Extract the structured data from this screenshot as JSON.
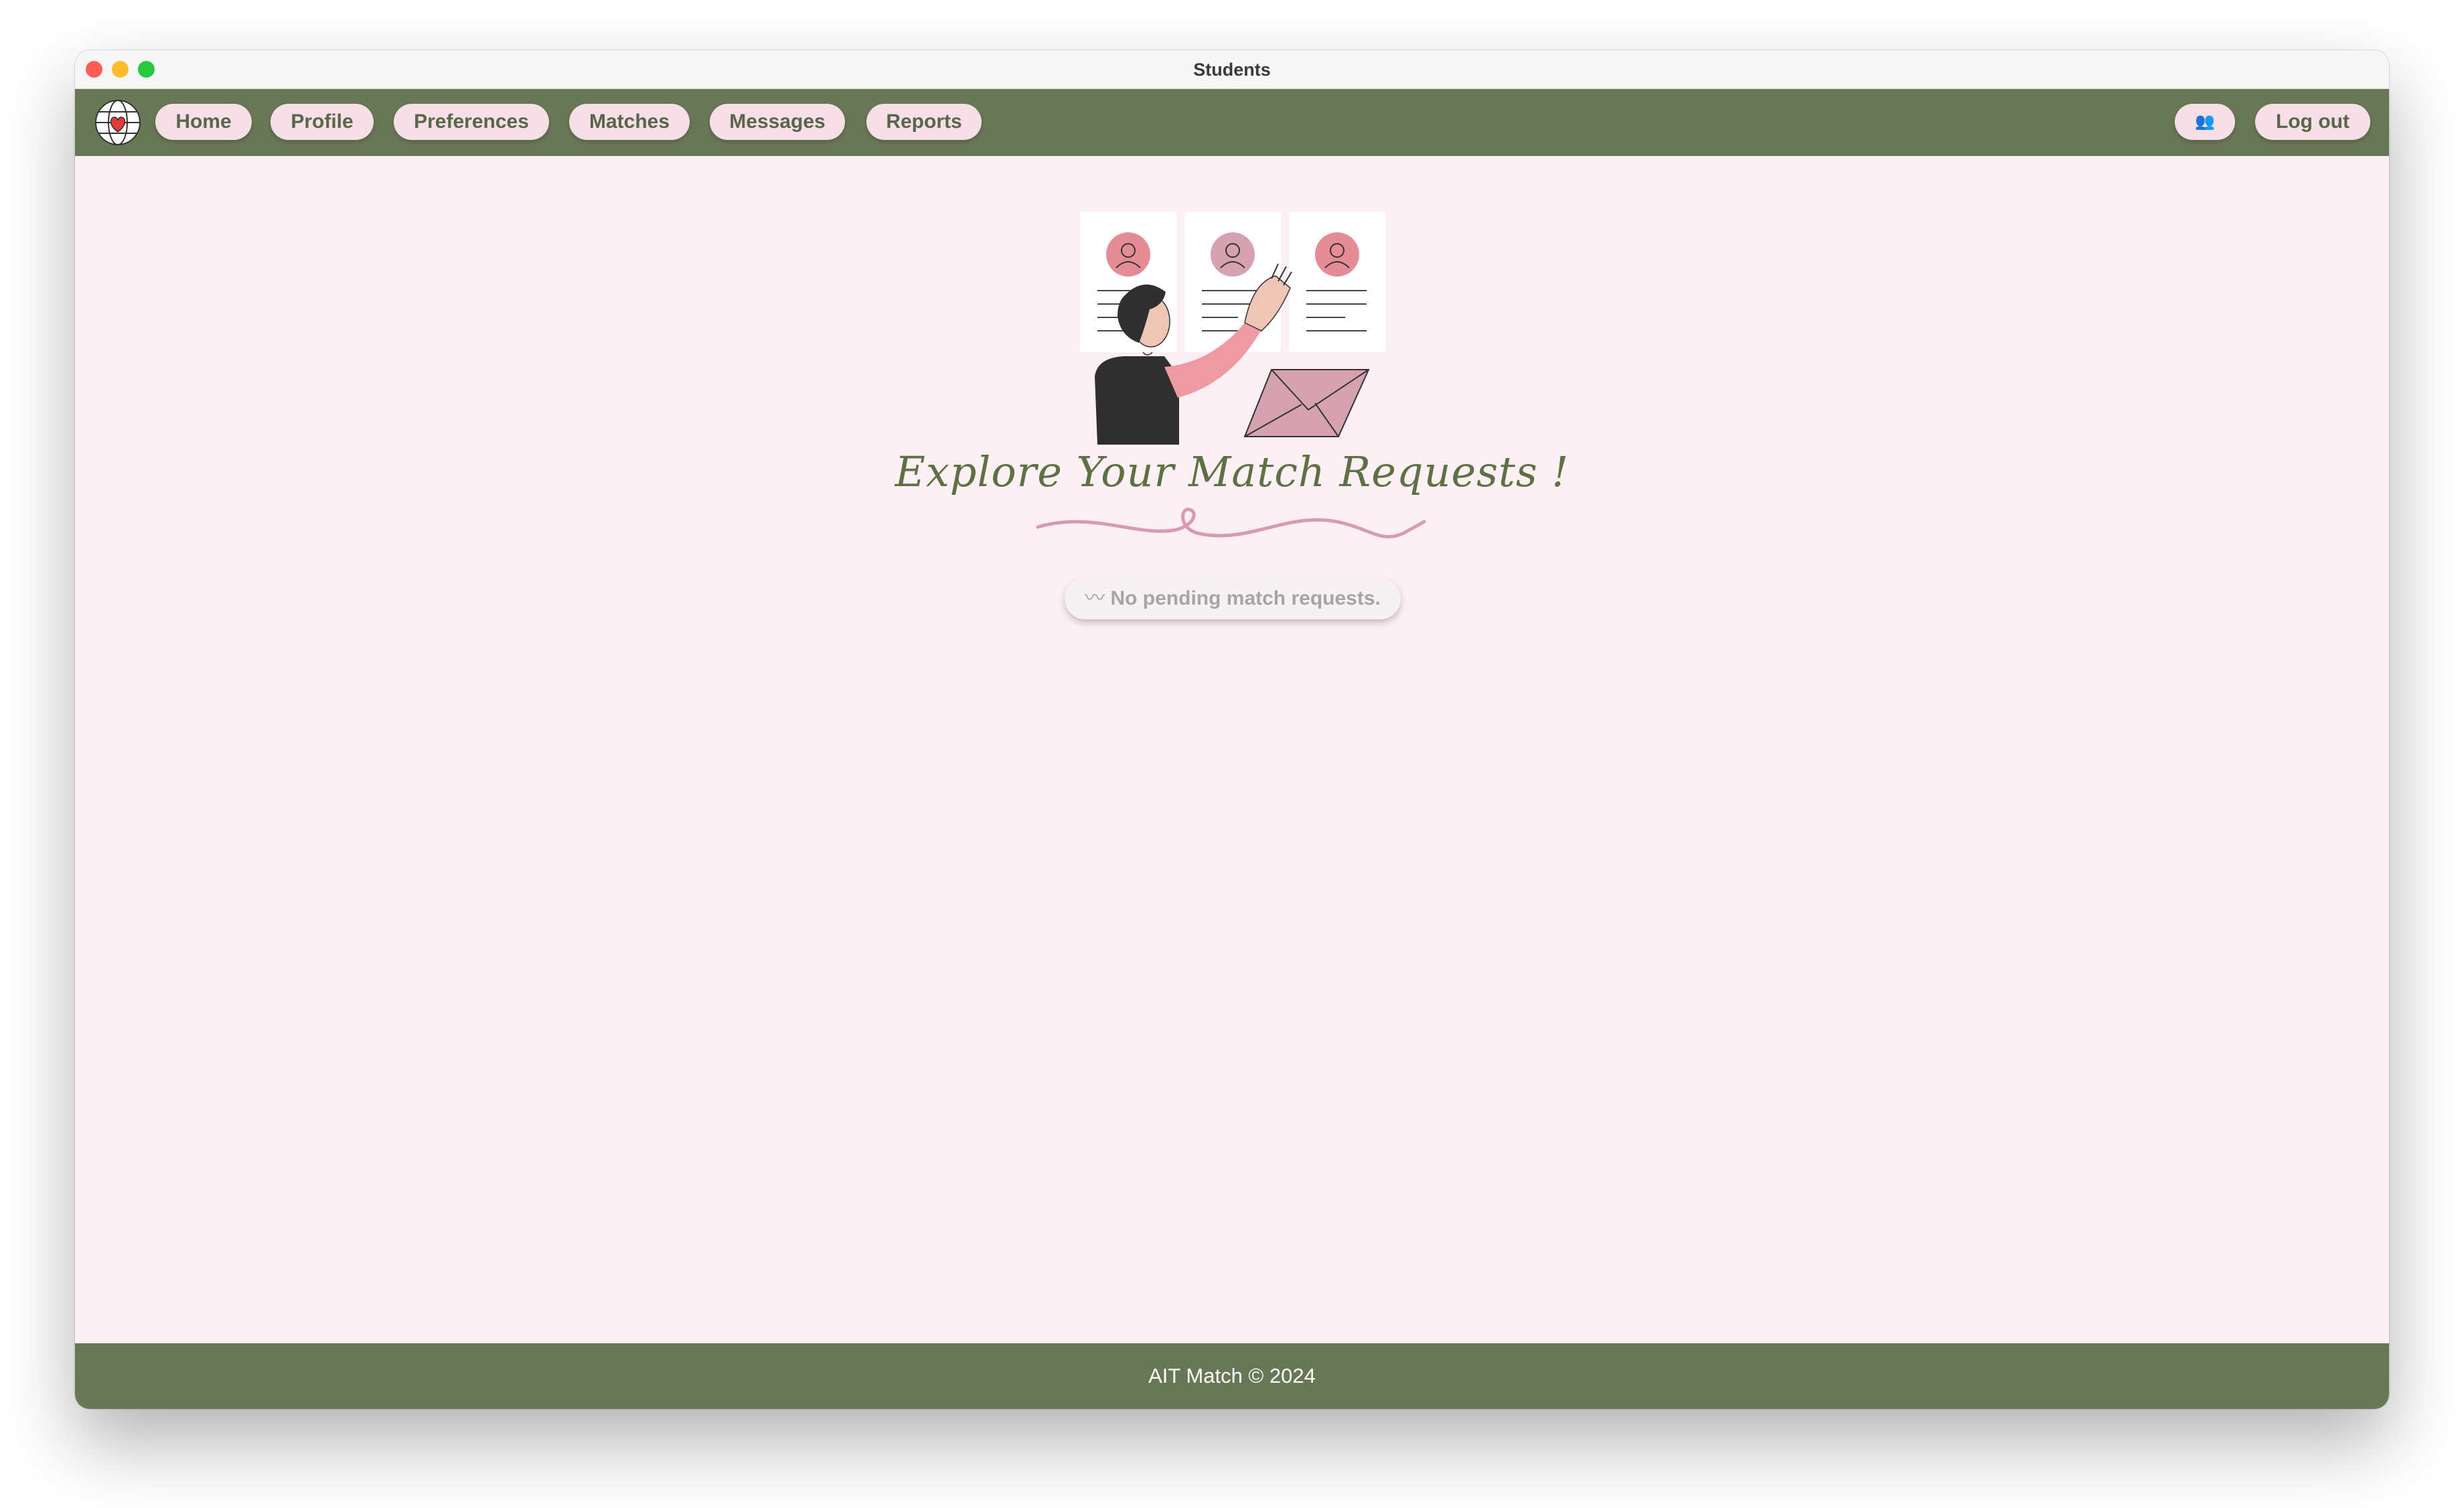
{
  "window": {
    "title": "Students"
  },
  "nav": {
    "logo_icon": "globe-heart-icon",
    "items": [
      {
        "label": "Home"
      },
      {
        "label": "Profile"
      },
      {
        "label": "Preferences"
      },
      {
        "label": "Matches"
      },
      {
        "label": "Messages"
      },
      {
        "label": "Reports"
      }
    ],
    "users_icon": "👥",
    "logout_label": "Log out"
  },
  "main": {
    "heading": "Explore Your Match Requests !",
    "status_icon": "〰",
    "status_text": "No pending match requests."
  },
  "footer": {
    "text": "AIT Match © 2024"
  },
  "colors": {
    "nav_green": "#687756",
    "pill_pink": "#f7dfe7",
    "page_bg": "#fcf0f4",
    "accent_pink": "#e58d97"
  }
}
